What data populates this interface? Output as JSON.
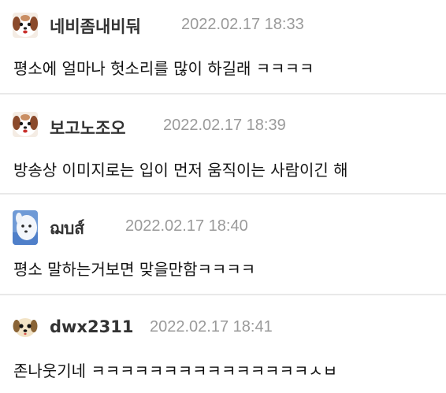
{
  "comments": [
    {
      "author": "네비좀내비둬",
      "timestamp": "2022.02.17 18:33",
      "text": "평소에 얼마나 헛소리를 많이 하길래 ㅋㅋㅋㅋ",
      "avatar_icon": "shih-tzu-dog-avatar-icon"
    },
    {
      "author": "보고노조오",
      "timestamp": "2022.02.17 18:39",
      "text": "방송상 이미지로는 입이 먼저 움직이는 사람이긴 해",
      "avatar_icon": "shih-tzu-dog-avatar-icon"
    },
    {
      "author": "ฌบส์",
      "timestamp": "2022.02.17 18:40",
      "text": "평소 말하는거보면 맞을만함ㅋㅋㅋㅋ",
      "avatar_icon": "white-dog-avatar-icon"
    },
    {
      "author": "dwx2311",
      "timestamp": "2022.02.17 18:41",
      "text": "존나웃기네 ㅋㅋㅋㅋㅋㅋㅋㅋㅋㅋㅋㅋㅋㅋㅋㅅㅂ",
      "avatar_icon": "puppy-face-avatar-icon"
    }
  ],
  "colors": {
    "author": "#333333",
    "timestamp": "#9a9a9a",
    "text": "#111111",
    "divider": "#e9e9e9",
    "background": "#ffffff"
  }
}
